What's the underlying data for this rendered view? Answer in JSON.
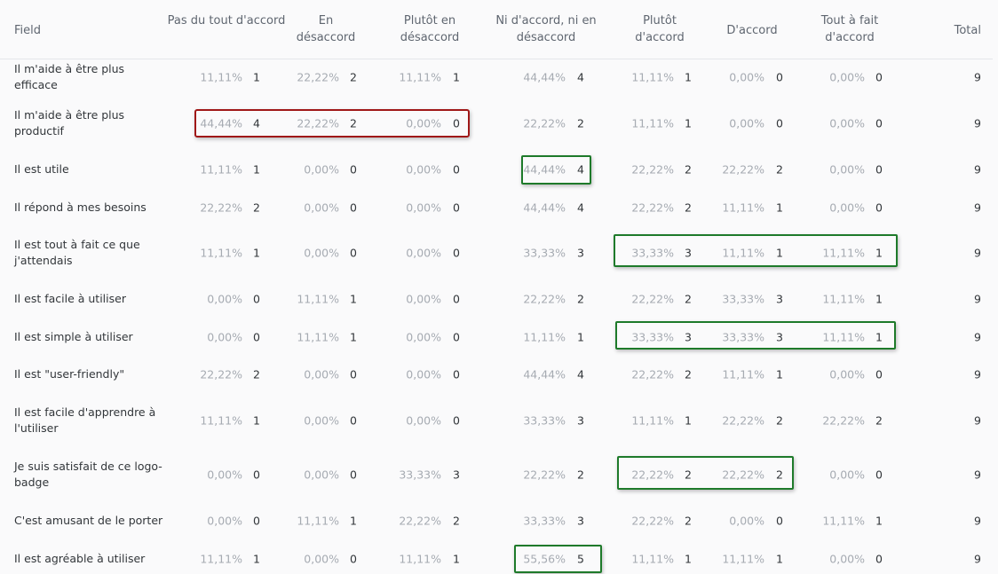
{
  "columns": [
    {
      "label": "Field"
    },
    {
      "label": "Pas du tout d'accord"
    },
    {
      "label": "En désaccord"
    },
    {
      "label": "Plutôt en désaccord"
    },
    {
      "label": "Ni d'accord, ni en désaccord"
    },
    {
      "label": "Plutôt d'accord"
    },
    {
      "label": "D'accord"
    },
    {
      "label": "Tout à fait d'accord"
    },
    {
      "label": "Total"
    }
  ],
  "rows": [
    {
      "label": "Il m'aide à être plus efficace",
      "cells": [
        [
          "11,11%",
          "1"
        ],
        [
          "22,22%",
          "2"
        ],
        [
          "11,11%",
          "1"
        ],
        [
          "44,44%",
          "4"
        ],
        [
          "11,11%",
          "1"
        ],
        [
          "0,00%",
          "0"
        ],
        [
          "0,00%",
          "0"
        ]
      ],
      "total": "9"
    },
    {
      "label": "Il m'aide à être plus productif",
      "cells": [
        [
          "44,44%",
          "4"
        ],
        [
          "22,22%",
          "2"
        ],
        [
          "0,00%",
          "0"
        ],
        [
          "22,22%",
          "2"
        ],
        [
          "11,11%",
          "1"
        ],
        [
          "0,00%",
          "0"
        ],
        [
          "0,00%",
          "0"
        ]
      ],
      "total": "9"
    },
    {
      "label": "Il est utile",
      "cells": [
        [
          "11,11%",
          "1"
        ],
        [
          "0,00%",
          "0"
        ],
        [
          "0,00%",
          "0"
        ],
        [
          "44,44%",
          "4"
        ],
        [
          "22,22%",
          "2"
        ],
        [
          "22,22%",
          "2"
        ],
        [
          "0,00%",
          "0"
        ]
      ],
      "total": "9"
    },
    {
      "label": "Il répond à mes besoins",
      "cells": [
        [
          "22,22%",
          "2"
        ],
        [
          "0,00%",
          "0"
        ],
        [
          "0,00%",
          "0"
        ],
        [
          "44,44%",
          "4"
        ],
        [
          "22,22%",
          "2"
        ],
        [
          "11,11%",
          "1"
        ],
        [
          "0,00%",
          "0"
        ]
      ],
      "total": "9"
    },
    {
      "label": "Il est tout à fait ce que j'attendais",
      "cells": [
        [
          "11,11%",
          "1"
        ],
        [
          "0,00%",
          "0"
        ],
        [
          "0,00%",
          "0"
        ],
        [
          "33,33%",
          "3"
        ],
        [
          "33,33%",
          "3"
        ],
        [
          "11,11%",
          "1"
        ],
        [
          "11,11%",
          "1"
        ]
      ],
      "total": "9"
    },
    {
      "label": "Il est facile à utiliser",
      "cells": [
        [
          "0,00%",
          "0"
        ],
        [
          "11,11%",
          "1"
        ],
        [
          "0,00%",
          "0"
        ],
        [
          "22,22%",
          "2"
        ],
        [
          "22,22%",
          "2"
        ],
        [
          "33,33%",
          "3"
        ],
        [
          "11,11%",
          "1"
        ]
      ],
      "total": "9"
    },
    {
      "label": "Il est simple à utiliser",
      "cells": [
        [
          "0,00%",
          "0"
        ],
        [
          "11,11%",
          "1"
        ],
        [
          "0,00%",
          "0"
        ],
        [
          "11,11%",
          "1"
        ],
        [
          "33,33%",
          "3"
        ],
        [
          "33,33%",
          "3"
        ],
        [
          "11,11%",
          "1"
        ]
      ],
      "total": "9"
    },
    {
      "label": "Il est \"user-friendly\"",
      "cells": [
        [
          "22,22%",
          "2"
        ],
        [
          "0,00%",
          "0"
        ],
        [
          "0,00%",
          "0"
        ],
        [
          "44,44%",
          "4"
        ],
        [
          "22,22%",
          "2"
        ],
        [
          "11,11%",
          "1"
        ],
        [
          "0,00%",
          "0"
        ]
      ],
      "total": "9"
    },
    {
      "label": "Il est facile d'apprendre à l'utiliser",
      "cells": [
        [
          "11,11%",
          "1"
        ],
        [
          "0,00%",
          "0"
        ],
        [
          "0,00%",
          "0"
        ],
        [
          "33,33%",
          "3"
        ],
        [
          "11,11%",
          "1"
        ],
        [
          "22,22%",
          "2"
        ],
        [
          "22,22%",
          "2"
        ]
      ],
      "total": "9"
    },
    {
      "label": "Je suis satisfait de ce logo-badge",
      "cells": [
        [
          "0,00%",
          "0"
        ],
        [
          "0,00%",
          "0"
        ],
        [
          "33,33%",
          "3"
        ],
        [
          "22,22%",
          "2"
        ],
        [
          "22,22%",
          "2"
        ],
        [
          "22,22%",
          "2"
        ],
        [
          "0,00%",
          "0"
        ]
      ],
      "total": "9"
    },
    {
      "label": "C'est amusant de le porter",
      "cells": [
        [
          "0,00%",
          "0"
        ],
        [
          "11,11%",
          "1"
        ],
        [
          "22,22%",
          "2"
        ],
        [
          "33,33%",
          "3"
        ],
        [
          "22,22%",
          "2"
        ],
        [
          "0,00%",
          "0"
        ],
        [
          "11,11%",
          "1"
        ]
      ],
      "total": "9"
    },
    {
      "label": "Il est agréable à utiliser",
      "cells": [
        [
          "11,11%",
          "1"
        ],
        [
          "0,00%",
          "0"
        ],
        [
          "11,11%",
          "1"
        ],
        [
          "55,56%",
          "5"
        ],
        [
          "11,11%",
          "1"
        ],
        [
          "11,11%",
          "1"
        ],
        [
          "0,00%",
          "0"
        ]
      ],
      "total": "9"
    }
  ],
  "highlights": [
    {
      "row": 1,
      "col_start": 0,
      "col_end": 2,
      "color": "#a01818"
    },
    {
      "row": 2,
      "col_start": 3,
      "col_end": 3,
      "color": "#1e7a2a"
    },
    {
      "row": 4,
      "col_start": 4,
      "col_end": 6,
      "color": "#1e7a2a"
    },
    {
      "row": 6,
      "col_start": 4,
      "col_end": 6,
      "color": "#1e7a2a"
    },
    {
      "row": 9,
      "col_start": 4,
      "col_end": 5,
      "color": "#1e7a2a"
    },
    {
      "row": 11,
      "col_start": 3,
      "col_end": 3,
      "color": "#1e7a2a"
    }
  ],
  "colors": {
    "percent_text": "#a6abb2",
    "count_text": "#32363a",
    "header_text": "#5f6670"
  }
}
